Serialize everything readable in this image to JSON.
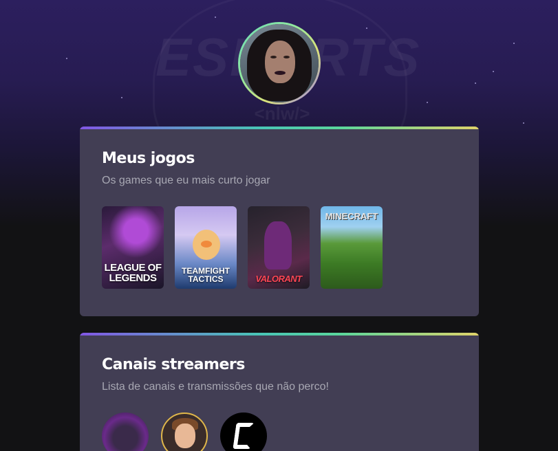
{
  "profile": {
    "avatar_alt": "Foto de perfil"
  },
  "games_section": {
    "title": "Meus jogos",
    "subtitle": "Os games que eu mais curto jogar",
    "games": [
      {
        "name": "League of Legends",
        "label_line1": "LEAGUE OF",
        "label_line2": "LEGENDS"
      },
      {
        "name": "Teamfight Tactics",
        "label_line1": "TEAMFIGHT",
        "label_line2": "TACTICS"
      },
      {
        "name": "Valorant",
        "label_line1": "VALORANT"
      },
      {
        "name": "Minecraft",
        "label_line1": "MINECRAFT"
      }
    ]
  },
  "streamers_section": {
    "title": "Canais streamers",
    "subtitle": "Lista de canais e transmissões que não perco!"
  },
  "colors": {
    "accent_gradient": [
      "#8257e5",
      "#49c5b6",
      "#5ad69c",
      "#e0d36a"
    ],
    "card_bg": "#423e54",
    "page_bg": "#121214"
  }
}
